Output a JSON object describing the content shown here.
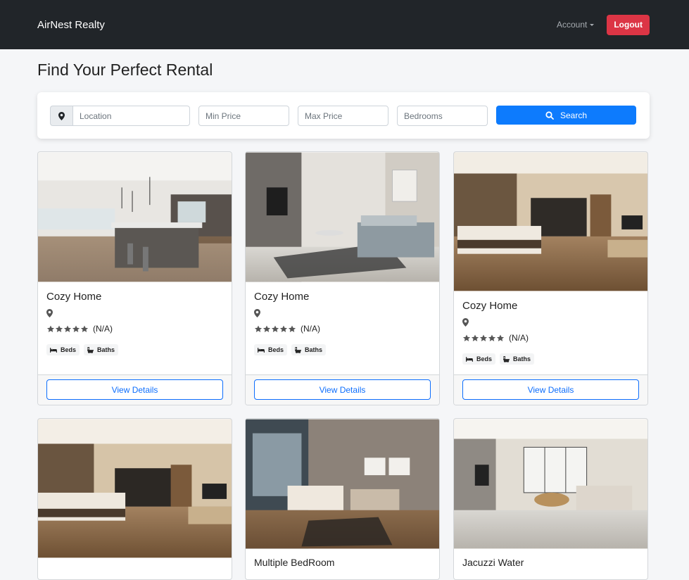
{
  "navbar": {
    "brand": "AirNest Realty",
    "account_label": "Account",
    "logout_label": "Logout",
    "logout_color": "#dc3545"
  },
  "page": {
    "title": "Find Your Perfect Rental"
  },
  "search": {
    "location_placeholder": "Location",
    "min_price_placeholder": "Min Price",
    "max_price_placeholder": "Max Price",
    "bedrooms_placeholder": "Bedrooms",
    "button_label": "Search",
    "button_color": "#0d7bfd"
  },
  "listings": [
    {
      "title": "Cozy Home",
      "rating_text": "(N/A)",
      "beds_label": "Beds",
      "baths_label": "Baths",
      "button_label": "View Details",
      "image": "kitchen-open-plan-photo"
    },
    {
      "title": "Cozy Home",
      "rating_text": "(N/A)",
      "beds_label": "Beds",
      "baths_label": "Baths",
      "button_label": "View Details",
      "image": "living-room-photo"
    },
    {
      "title": "Cozy Home",
      "rating_text": "(N/A)",
      "beds_label": "Beds",
      "baths_label": "Baths",
      "button_label": "View Details",
      "image": "bedroom-suite-photo"
    },
    {
      "title": "",
      "image": "bedroom-suite-photo"
    },
    {
      "title": "Multiple BedRoom",
      "image": "hotel-bedroom-photo"
    },
    {
      "title": "Jacuzzi Water",
      "image": "luxury-living-room-photo"
    }
  ]
}
